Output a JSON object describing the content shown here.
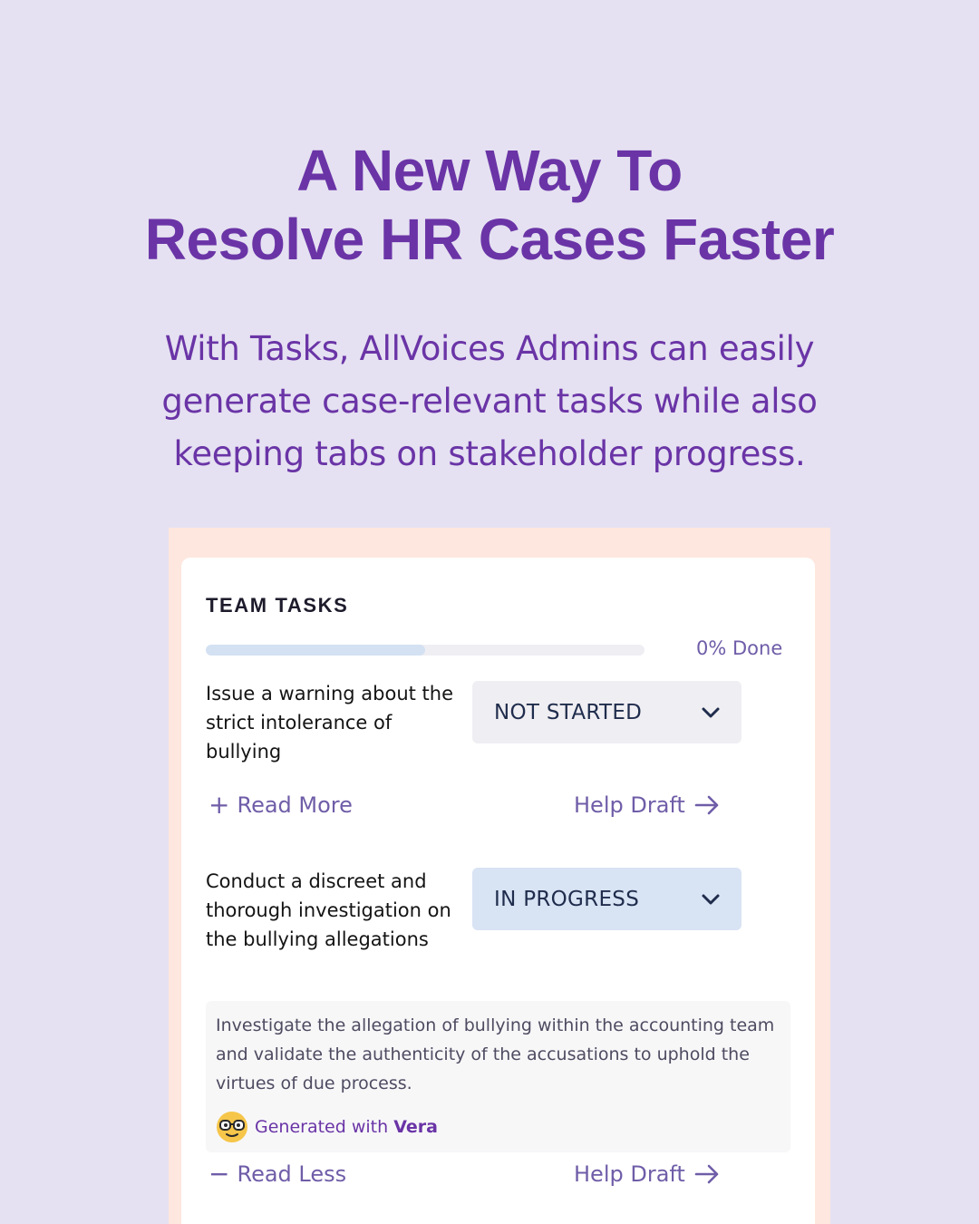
{
  "headline": {
    "line1": "A New Way To",
    "line2": "Resolve HR Cases Faster"
  },
  "subheadline": {
    "line1": "With Tasks, AllVoices Admins can easily",
    "line2": "generate case-relevant tasks while also",
    "line3": "keeping tabs on stakeholder progress."
  },
  "card": {
    "title": "TEAM TASKS",
    "progress": {
      "fraction_done": 0.5,
      "label": "0% Done"
    },
    "tasks": [
      {
        "text": "Issue a warning about the strict intolerance of bullying",
        "status": "NOT STARTED",
        "expand_label": "Read More",
        "expand_icon": "plus-icon",
        "help_label": "Help Draft"
      },
      {
        "text": "Conduct a discreet and thorough investigation on the bullying allegations",
        "status": "IN PROGRESS",
        "description": "Investigate the allegation of bullying within the accounting team and validate the authenticity of the accusations to uphold the virtues of due process.",
        "generated_prefix": "Generated with",
        "generated_brand": "Vera",
        "expand_label": "Read Less",
        "expand_icon": "minus-icon",
        "help_label": "Help Draft"
      }
    ]
  },
  "colors": {
    "background": "#e5e1f2",
    "accent_purple": "#6a34a6",
    "link_purple": "#6f5da8",
    "frame_peach": "#fde7df",
    "status_grey": "#efeef2",
    "status_blue": "#d8e3f4",
    "progress_fill": "#d4e1f3"
  }
}
